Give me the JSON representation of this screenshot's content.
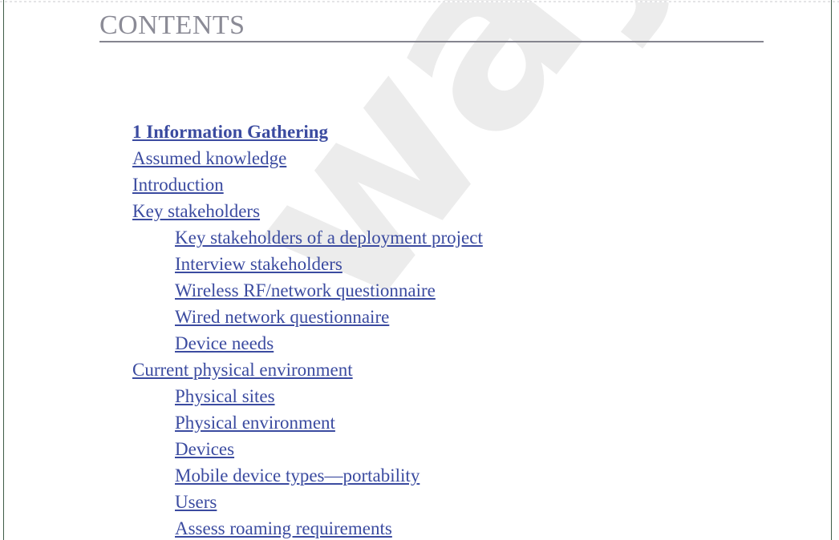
{
  "page": {
    "heading": "CONTENTS",
    "watermark_text": "way",
    "colors": {
      "heading": "#8b8b96",
      "heading_rule": "#85858f",
      "link": "#3b4ba0",
      "watermark": "#ececec",
      "page_edge": "#3f5c47",
      "background": "#ffffff"
    }
  },
  "toc": {
    "entries": [
      {
        "label": "1 Information Gathering",
        "level": 1,
        "bold": true
      },
      {
        "label": "Assumed knowledge",
        "level": 1,
        "bold": false
      },
      {
        "label": "Introduction",
        "level": 1,
        "bold": false
      },
      {
        "label": "Key stakeholders",
        "level": 1,
        "bold": false
      },
      {
        "label": "Key stakeholders of a deployment project",
        "level": 2,
        "bold": false
      },
      {
        "label": "Interview stakeholders",
        "level": 2,
        "bold": false
      },
      {
        "label": "Wireless RF/network questionnaire",
        "level": 2,
        "bold": false
      },
      {
        "label": "Wired network questionnaire",
        "level": 2,
        "bold": false
      },
      {
        "label": "Device needs",
        "level": 2,
        "bold": false
      },
      {
        "label": "Current physical environment",
        "level": 1,
        "bold": false
      },
      {
        "label": "Physical sites",
        "level": 2,
        "bold": false
      },
      {
        "label": "Physical environment",
        "level": 2,
        "bold": false
      },
      {
        "label": "Devices",
        "level": 2,
        "bold": false
      },
      {
        "label": "Mobile device types—portability",
        "level": 2,
        "bold": false
      },
      {
        "label": "Users",
        "level": 2,
        "bold": false
      },
      {
        "label": "Assess roaming requirements",
        "level": 2,
        "bold": false
      }
    ]
  }
}
